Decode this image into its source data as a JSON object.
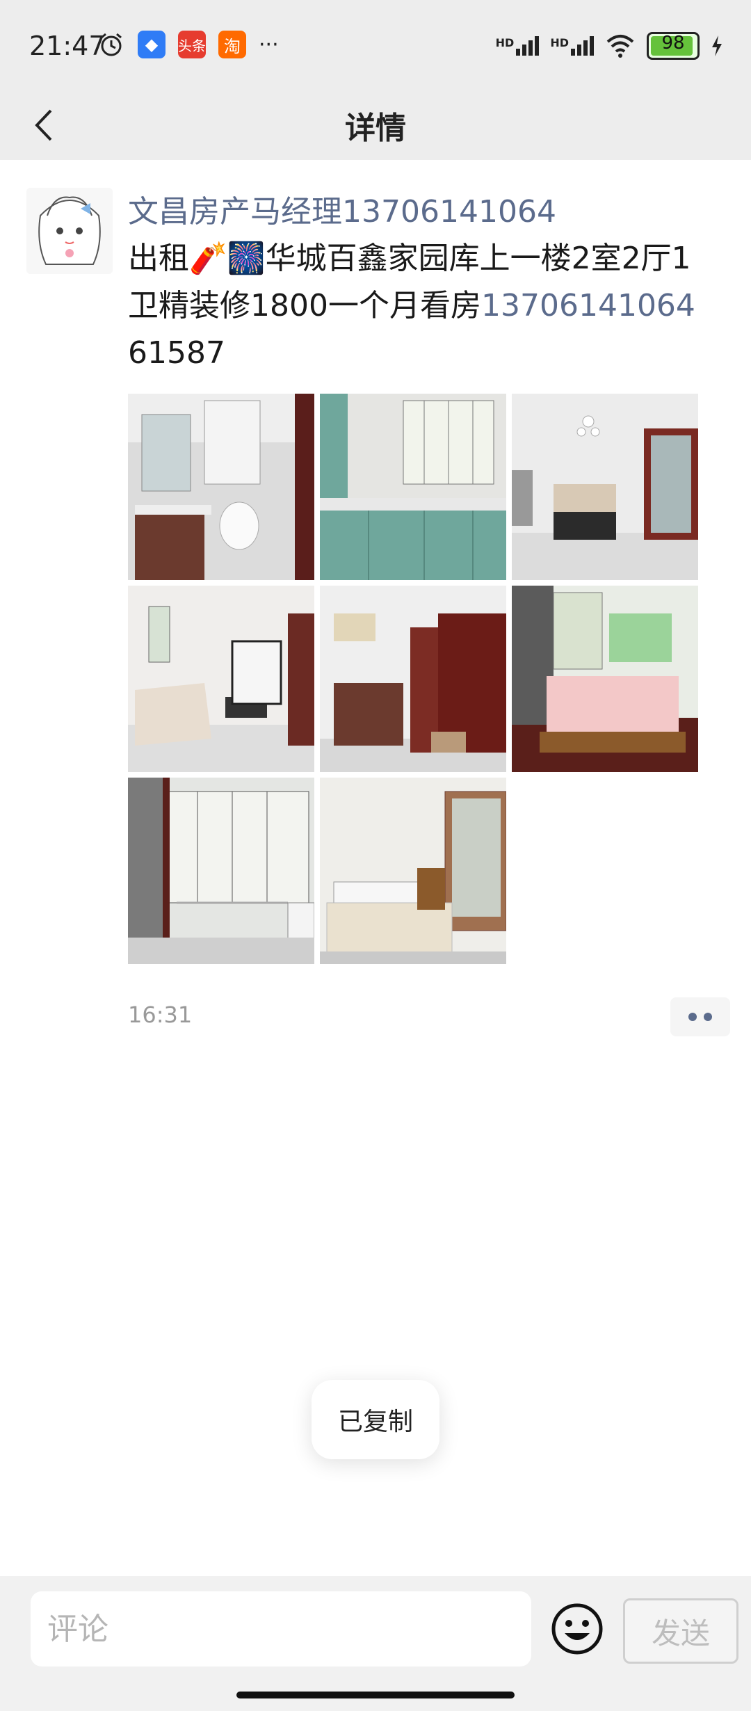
{
  "status_bar": {
    "time": "21:47",
    "signal_left_label": "HD",
    "signal_right_label": "HD",
    "battery_level": "98",
    "more_icon": "···"
  },
  "header": {
    "title": "详情"
  },
  "post": {
    "author": "文昌房产马经理13706141064",
    "content_prefix": "出租🧨🎆华城百鑫家园库上一楼2室2厅1卫精装修1800一个月看房",
    "phone": "13706141064",
    "content_suffix": "61587",
    "time": "16:31",
    "photos": [
      {
        "label": "bathroom"
      },
      {
        "label": "kitchen"
      },
      {
        "label": "dining-room"
      },
      {
        "label": "living-room"
      },
      {
        "label": "entrance"
      },
      {
        "label": "bedroom"
      },
      {
        "label": "balcony"
      },
      {
        "label": "bedroom-2"
      }
    ]
  },
  "toast": {
    "text": "已复制"
  },
  "bottom_bar": {
    "comment_placeholder": "评论",
    "send_label": "发送"
  },
  "colors": {
    "link": "#5b6b8c",
    "bar_bg": "#ededed"
  }
}
